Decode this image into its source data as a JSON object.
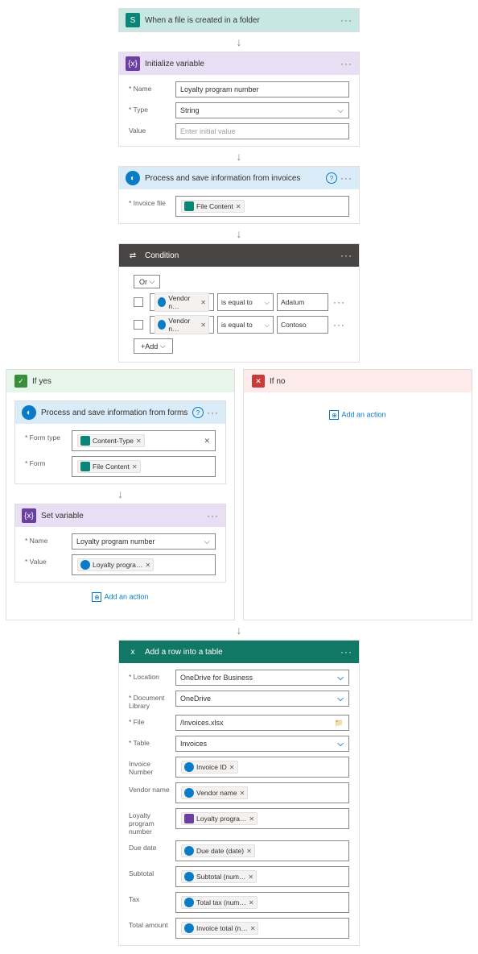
{
  "trigger": {
    "title": "When a file is created in a folder"
  },
  "init_var": {
    "title": "Initialize variable",
    "name_label": "Name",
    "name_val": "Loyalty program number",
    "type_label": "Type",
    "type_val": "String",
    "value_label": "Value",
    "value_ph": "Enter initial value"
  },
  "process_inv": {
    "title": "Process and save information from invoices",
    "file_label": "Invoice file",
    "token": "File Content"
  },
  "condition": {
    "title": "Condition",
    "or": "Or",
    "rows": [
      {
        "l_token": "Vendor n…",
        "op": "is equal to",
        "r": "Adatum"
      },
      {
        "l_token": "Vendor n…",
        "op": "is equal to",
        "r": "Contoso"
      }
    ],
    "add": "Add"
  },
  "yes": {
    "label": "If yes",
    "process_forms": {
      "title": "Process and save information from  forms",
      "type_label": "Form type",
      "type_token": "Content-Type",
      "form_label": "Form",
      "form_token": "File Content"
    },
    "set_var": {
      "title": "Set variable",
      "name_label": "Name",
      "name_val": "Loyalty program number",
      "value_label": "Value",
      "value_token": "Loyalty progra…"
    },
    "add_action": "Add an action"
  },
  "no": {
    "label": "If no",
    "add_action": "Add an action"
  },
  "excel": {
    "title": "Add a row into a table",
    "loc_label": "Location",
    "loc_val": "OneDrive for Business",
    "lib_label": "Document Library",
    "lib_val": "OneDrive",
    "file_label": "File",
    "file_val": "/Invoices.xlsx",
    "table_label": "Table",
    "table_val": "Invoices",
    "rows": [
      {
        "label": "Invoice Number",
        "token": "Invoice ID",
        "color": "blue"
      },
      {
        "label": "Vendor name",
        "token": "Vendor name",
        "color": "blue"
      },
      {
        "label": "Loyalty program number",
        "token": "Loyalty progra…",
        "color": "purple"
      },
      {
        "label": "Due date",
        "token": "Due date (date)",
        "color": "blue"
      },
      {
        "label": "Subtotal",
        "token": "Subtotal (num…",
        "color": "blue"
      },
      {
        "label": "Tax",
        "token": "Total tax (num…",
        "color": "blue"
      },
      {
        "label": "Total amount",
        "token": "Invoice total (n…",
        "color": "blue"
      }
    ]
  }
}
